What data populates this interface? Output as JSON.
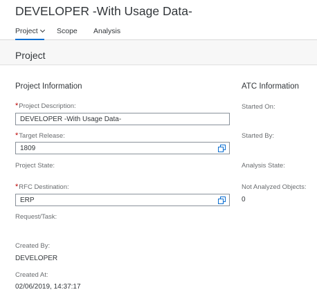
{
  "app": {
    "title": "DEVELOPER -With Usage Data-"
  },
  "tabs": [
    {
      "label": "Project"
    },
    {
      "label": "Scope"
    },
    {
      "label": "Analysis"
    }
  ],
  "section": {
    "title": "Project"
  },
  "project_info": {
    "title": "Project Information",
    "description_label": "Project Description:",
    "description_value": "DEVELOPER -With Usage Data-",
    "release_label": "Target Release:",
    "release_value": "1809",
    "state_label": "Project State:",
    "rfc_label": "RFC Destination:",
    "rfc_value": "ERP",
    "request_label": "Request/Task:",
    "created_by_label": "Created By:",
    "created_by_value": "DEVELOPER",
    "created_at_label": "Created At:",
    "created_at_value": "02/06/2019, 14:37:17"
  },
  "atc_info": {
    "title": "ATC Information",
    "started_on_label": "Started On:",
    "started_by_label": "Started By:",
    "analysis_state_label": "Analysis State:",
    "not_analyzed_label": "Not Analyzed Objects:",
    "not_analyzed_value": "0"
  },
  "colors": {
    "accent": "#0a6ed1",
    "required": "#bb0000",
    "text": "#32363a",
    "label": "#6a6d70"
  },
  "icons": {
    "value_help": "value-help-icon",
    "tab_dropdown": "chevron-down-icon"
  }
}
